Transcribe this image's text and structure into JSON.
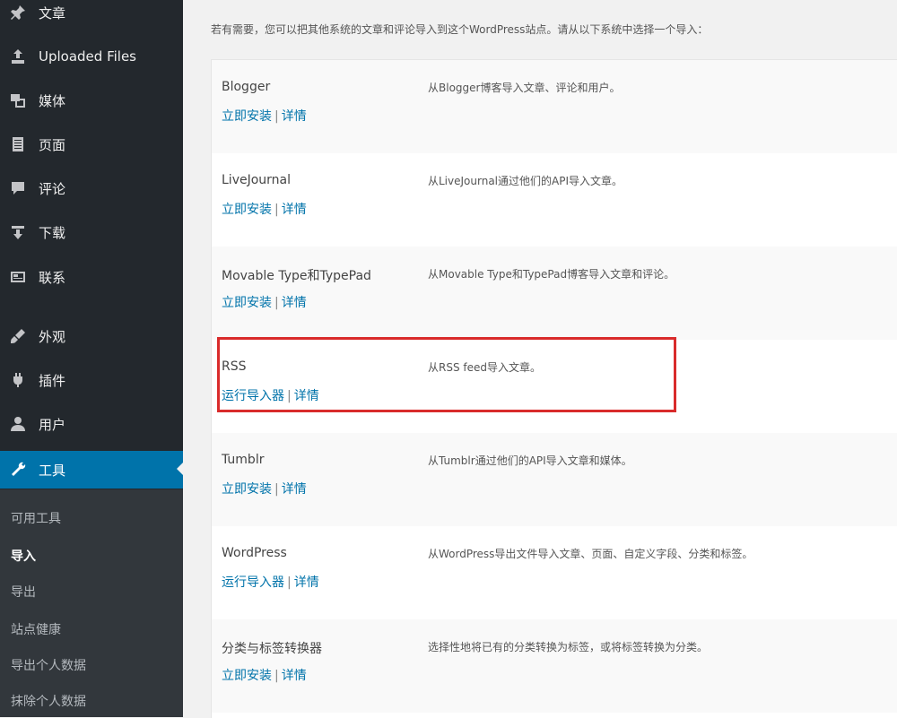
{
  "sidebar": {
    "items": [
      {
        "label": "文章",
        "icon": "pin-icon"
      },
      {
        "label": "Uploaded Files",
        "icon": "upload-icon"
      },
      {
        "label": "媒体",
        "icon": "media-icon"
      },
      {
        "label": "页面",
        "icon": "page-icon"
      },
      {
        "label": "评论",
        "icon": "comment-icon"
      },
      {
        "label": "下载",
        "icon": "download-icon"
      },
      {
        "label": "联系",
        "icon": "contact-icon"
      },
      {
        "label": "外观",
        "icon": "appearance-icon"
      },
      {
        "label": "插件",
        "icon": "plugin-icon"
      },
      {
        "label": "用户",
        "icon": "user-icon"
      },
      {
        "label": "工具",
        "icon": "tools-icon",
        "active": true
      }
    ],
    "submenu": [
      {
        "label": "可用工具"
      },
      {
        "label": "导入",
        "current": true
      },
      {
        "label": "导出"
      },
      {
        "label": "站点健康"
      },
      {
        "label": "导出个人数据"
      },
      {
        "label": "抹除个人数据"
      }
    ]
  },
  "main": {
    "intro": "若有需要，您可以把其他系统的文章和评论导入到这个WordPress站点。请从以下系统中选择一个导入：",
    "importers": [
      {
        "name": "Blogger",
        "action": "立即安装",
        "details": "详情",
        "description": "从Blogger博客导入文章、评论和用户。"
      },
      {
        "name": "LiveJournal",
        "action": "立即安装",
        "details": "详情",
        "description": "从LiveJournal通过他们的API导入文章。"
      },
      {
        "name": "Movable Type和TypePad",
        "action": "立即安装",
        "details": "详情",
        "description": "从Movable Type和TypePad博客导入文章和评论。"
      },
      {
        "name": "RSS",
        "action": "运行导入器",
        "details": "详情",
        "description": "从RSS feed导入文章。"
      },
      {
        "name": "Tumblr",
        "action": "立即安装",
        "details": "详情",
        "description": "从Tumblr通过他们的API导入文章和媒体。"
      },
      {
        "name": "WordPress",
        "action": "运行导入器",
        "details": "详情",
        "description": "从WordPress导出文件导入文章、页面、自定义字段、分类和标签。"
      },
      {
        "name": "分类与标签转换器",
        "action": "立即安装",
        "details": "详情",
        "description": "选择性地将已有的分类转换为标签，或将标签转换为分类。"
      }
    ],
    "action_separator": "|"
  },
  "colors": {
    "sidebar_bg": "#23282d",
    "active_bg": "#0073aa",
    "link": "#0073aa",
    "highlight": "#d92b2b"
  }
}
